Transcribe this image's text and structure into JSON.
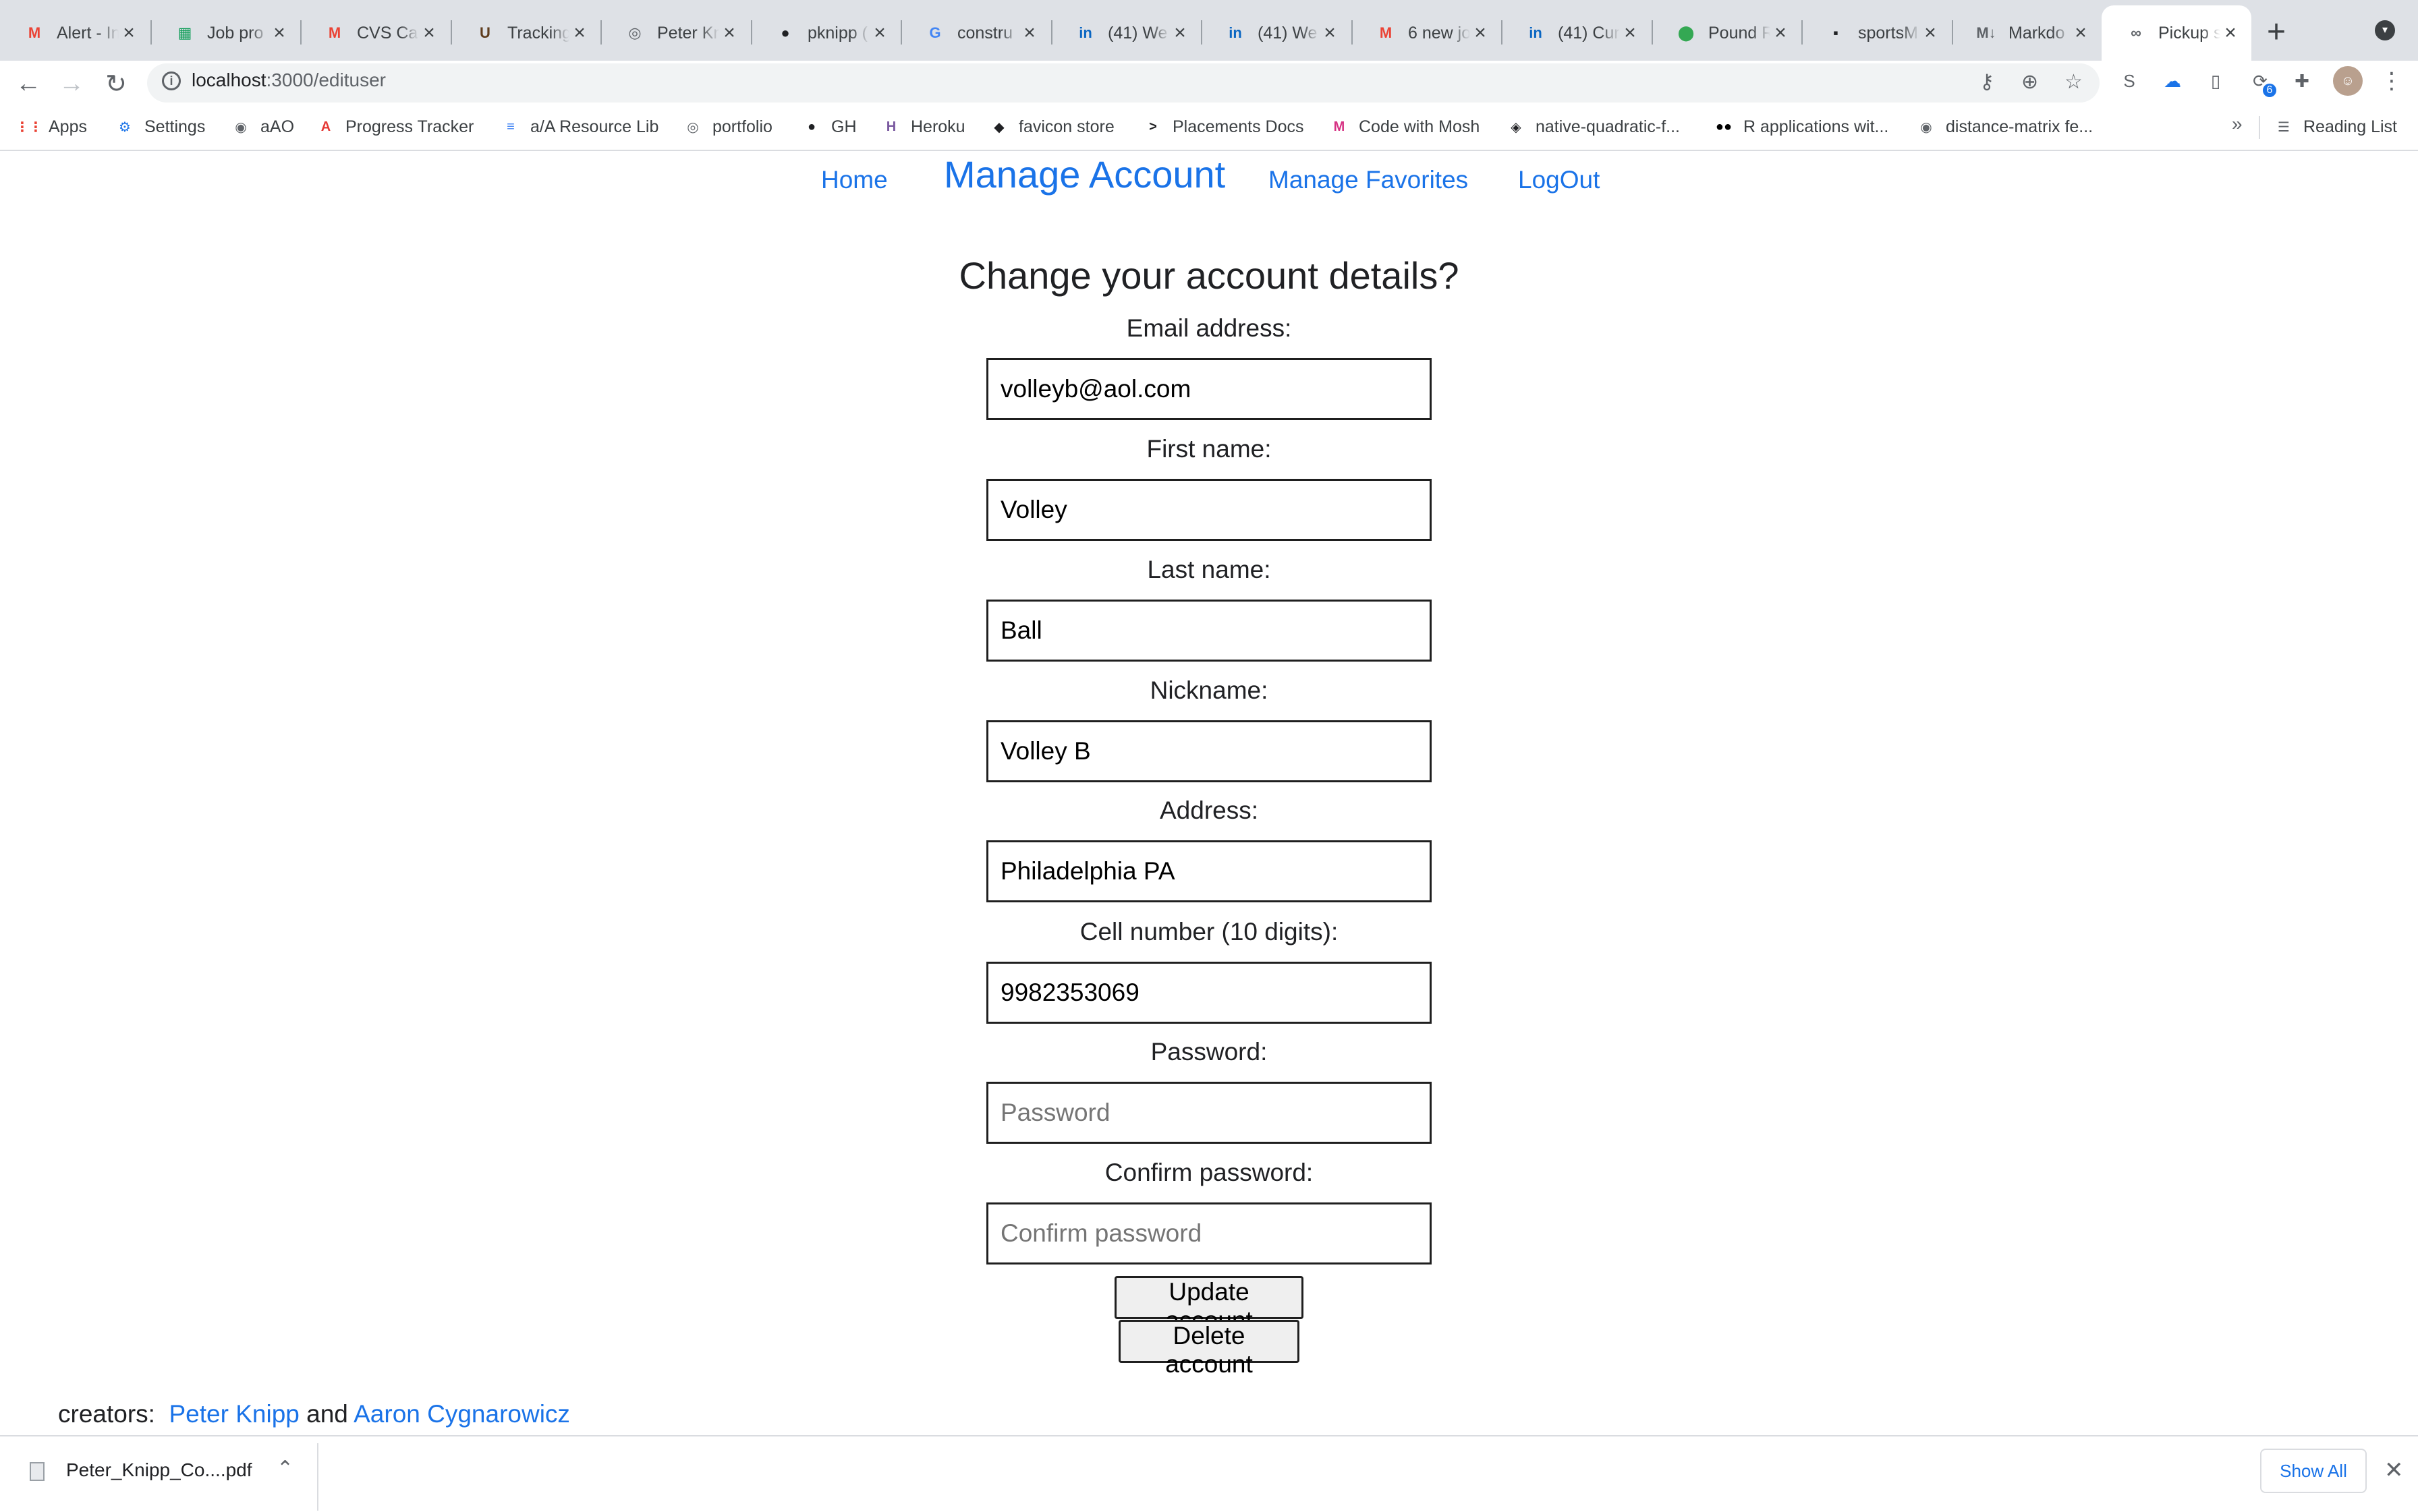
{
  "browser": {
    "tabs": [
      {
        "title": "Alert - In",
        "icon": "gmail-icon",
        "glyph": "M",
        "color": "#ea4335",
        "active": false
      },
      {
        "title": "Job pro",
        "icon": "sheets-icon",
        "glyph": "▦",
        "color": "#0f9d58",
        "active": false
      },
      {
        "title": "CVS Ca",
        "icon": "gmail-icon",
        "glyph": "M",
        "color": "#ea4335",
        "active": false
      },
      {
        "title": "Tracking",
        "icon": "ups-icon",
        "glyph": "U",
        "color": "#5f3d1e",
        "active": false
      },
      {
        "title": "Peter Kn",
        "icon": "globe-icon",
        "glyph": "◎",
        "color": "#5f6368",
        "active": false
      },
      {
        "title": "pknipp (",
        "icon": "github-icon",
        "glyph": "●",
        "color": "#202124",
        "active": false
      },
      {
        "title": "constru",
        "icon": "google-icon",
        "glyph": "G",
        "color": "#4285f4",
        "active": false
      },
      {
        "title": "(41) We",
        "icon": "linkedin-icon",
        "glyph": "in",
        "color": "#0a66c2",
        "active": false
      },
      {
        "title": "(41) We",
        "icon": "linkedin-icon",
        "glyph": "in",
        "color": "#0a66c2",
        "active": false
      },
      {
        "title": "6 new jo",
        "icon": "gmail-icon",
        "glyph": "M",
        "color": "#ea4335",
        "active": false
      },
      {
        "title": "(41) Cur",
        "icon": "linkedin-icon",
        "glyph": "in",
        "color": "#0a66c2",
        "active": false
      },
      {
        "title": "Pound R",
        "icon": "maps-pin-icon",
        "glyph": "⬤",
        "color": "#34a853",
        "active": false
      },
      {
        "title": "sportsM",
        "icon": "app-icon",
        "glyph": "▪",
        "color": "#202124",
        "active": false
      },
      {
        "title": "Markdo",
        "icon": "markdown-icon",
        "glyph": "M↓",
        "color": "#5f6368",
        "active": false
      },
      {
        "title": "Pickup s",
        "icon": "link-icon",
        "glyph": "∞",
        "color": "#5f6368",
        "active": true
      }
    ],
    "url_host": "localhost",
    "url_path": ":3000/edituser",
    "bookmarks": [
      {
        "label": "Apps",
        "icon": "apps-grid-icon",
        "glyph": "⋮⋮",
        "color": "#ea4335"
      },
      {
        "label": "Settings",
        "icon": "gear-icon",
        "glyph": "⚙",
        "color": "#1a73e8"
      },
      {
        "label": "aAO",
        "icon": "globe-icon",
        "glyph": "◉",
        "color": "#5f6368"
      },
      {
        "label": "Progress Tracker",
        "icon": "progress-icon",
        "glyph": "A",
        "color": "#e53935"
      },
      {
        "label": "a/A Resource Lib",
        "icon": "docs-icon",
        "glyph": "≡",
        "color": "#4285f4"
      },
      {
        "label": "portfolio",
        "icon": "globe-icon",
        "glyph": "◎",
        "color": "#5f6368"
      },
      {
        "label": "GH",
        "icon": "github-icon",
        "glyph": "●",
        "color": "#202124"
      },
      {
        "label": "Heroku",
        "icon": "heroku-icon",
        "glyph": "H",
        "color": "#79589f"
      },
      {
        "label": "favicon store",
        "icon": "favicon-store-icon",
        "glyph": "◆",
        "color": "#202124"
      },
      {
        "label": "Placements Docs",
        "icon": "terminal-icon",
        "glyph": ">",
        "color": "#202124"
      },
      {
        "label": "Code with Mosh",
        "icon": "mosh-icon",
        "glyph": "M",
        "color": "#d63384"
      },
      {
        "label": "native-quadratic-f...",
        "icon": "cube-icon",
        "glyph": "◈",
        "color": "#202124"
      },
      {
        "label": "R applications wit...",
        "icon": "medium-icon",
        "glyph": "●●",
        "color": "#000000"
      },
      {
        "label": "distance-matrix fe...",
        "icon": "globe-icon",
        "glyph": "◉",
        "color": "#5f6368"
      }
    ],
    "reading_list": "Reading List",
    "extension_badge": "6"
  },
  "page": {
    "nav": {
      "home": "Home",
      "manage_account": "Manage Account",
      "manage_favorites": "Manage Favorites",
      "logout": "LogOut"
    },
    "heading": "Change your account details?",
    "fields": [
      {
        "label": "Email address:",
        "value": "volleyb@aol.com",
        "placeholder": ""
      },
      {
        "label": "First name:",
        "value": "Volley",
        "placeholder": ""
      },
      {
        "label": "Last name:",
        "value": "Ball",
        "placeholder": ""
      },
      {
        "label": "Nickname:",
        "value": "Volley B",
        "placeholder": ""
      },
      {
        "label": "Address:",
        "value": "Philadelphia PA",
        "placeholder": ""
      },
      {
        "label": "Cell number (10 digits):",
        "value": "9982353069",
        "placeholder": ""
      },
      {
        "label": "Password:",
        "value": "",
        "placeholder": "Password"
      },
      {
        "label": "Confirm password:",
        "value": "",
        "placeholder": "Confirm password"
      }
    ],
    "update_button": "Update account",
    "delete_button": "Delete account",
    "footer": {
      "prefix": "creators:",
      "creator1": "Peter Knipp",
      "conjunction": "and",
      "creator2": "Aaron Cygnarowicz"
    }
  },
  "downloads": {
    "file_name": "Peter_Knipp_Co....pdf",
    "show_all": "Show All"
  }
}
